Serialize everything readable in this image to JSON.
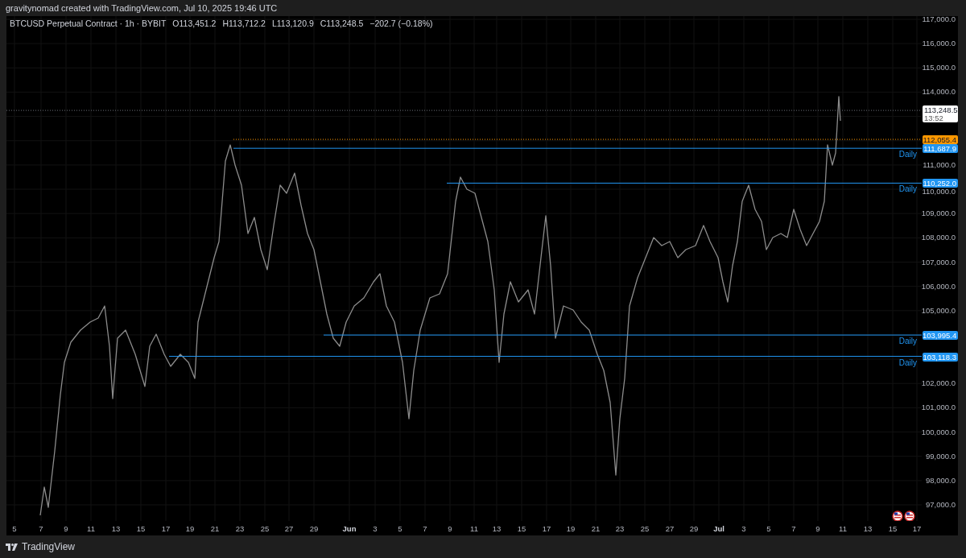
{
  "attribution": "gravitynomad created with TradingView.com, Jul 10, 2025 19:46 UTC",
  "legend": {
    "symbol": "BTCUSD Perpetual Contract · 1h · BYBIT",
    "ohlc": [
      {
        "label": "O",
        "value": "113,451.2"
      },
      {
        "label": "H",
        "value": "113,712.2"
      },
      {
        "label": "L",
        "value": "113,120.9"
      },
      {
        "label": "C",
        "value": "113,248.5"
      }
    ],
    "change": "−202.7 (−0.18%)"
  },
  "price_axis": {
    "labels": [
      "117,000.0",
      "116,000.0",
      "115,000.0",
      "114,000.0",
      "111,000.0",
      "110,000.0",
      "109,000.0",
      "108,000.0",
      "107,000.0",
      "106,000.0",
      "105,000.0",
      "102,000.0",
      "101,000.0",
      "100,000.0",
      "99,000.0",
      "98,000.0",
      "97,000.0"
    ]
  },
  "current_price": {
    "price": "113,248.5",
    "countdown": "13:52"
  },
  "levels": [
    {
      "kind": "alert",
      "price": "112,055.4",
      "color": "#ff9800"
    },
    {
      "kind": "line",
      "price": "111,687.9",
      "note": "Daily",
      "color": "#2196f3"
    },
    {
      "kind": "line",
      "price": "110,252.0",
      "note": "Daily",
      "color": "#2196f3"
    },
    {
      "kind": "line",
      "price": "103,995.4",
      "note": "Daily",
      "color": "#2196f3"
    },
    {
      "kind": "line",
      "price": "103,118.3",
      "note": "Daily",
      "color": "#2196f3"
    }
  ],
  "time_axis": {
    "labels": [
      {
        "text": "5",
        "kind": "day"
      },
      {
        "text": "7",
        "kind": "day"
      },
      {
        "text": "9",
        "kind": "day"
      },
      {
        "text": "11",
        "kind": "day"
      },
      {
        "text": "13",
        "kind": "day"
      },
      {
        "text": "15",
        "kind": "day"
      },
      {
        "text": "17",
        "kind": "day"
      },
      {
        "text": "19",
        "kind": "day"
      },
      {
        "text": "21",
        "kind": "day"
      },
      {
        "text": "23",
        "kind": "day"
      },
      {
        "text": "25",
        "kind": "day"
      },
      {
        "text": "27",
        "kind": "day"
      },
      {
        "text": "29",
        "kind": "day"
      },
      {
        "text": "Jun",
        "kind": "month"
      },
      {
        "text": "3",
        "kind": "day"
      },
      {
        "text": "5",
        "kind": "day"
      },
      {
        "text": "7",
        "kind": "day"
      },
      {
        "text": "9",
        "kind": "day"
      },
      {
        "text": "11",
        "kind": "day"
      },
      {
        "text": "13",
        "kind": "day"
      },
      {
        "text": "15",
        "kind": "day"
      },
      {
        "text": "17",
        "kind": "day"
      },
      {
        "text": "19",
        "kind": "day"
      },
      {
        "text": "21",
        "kind": "day"
      },
      {
        "text": "23",
        "kind": "day"
      },
      {
        "text": "25",
        "kind": "day"
      },
      {
        "text": "27",
        "kind": "day"
      },
      {
        "text": "29",
        "kind": "day"
      },
      {
        "text": "Jul",
        "kind": "month"
      },
      {
        "text": "3",
        "kind": "day"
      },
      {
        "text": "5",
        "kind": "day"
      },
      {
        "text": "7",
        "kind": "day"
      },
      {
        "text": "9",
        "kind": "day"
      },
      {
        "text": "11",
        "kind": "day"
      },
      {
        "text": "13",
        "kind": "day"
      },
      {
        "text": "15",
        "kind": "day"
      },
      {
        "text": "17",
        "kind": "day"
      }
    ]
  },
  "footer": {
    "brand": "TradingView"
  }
}
